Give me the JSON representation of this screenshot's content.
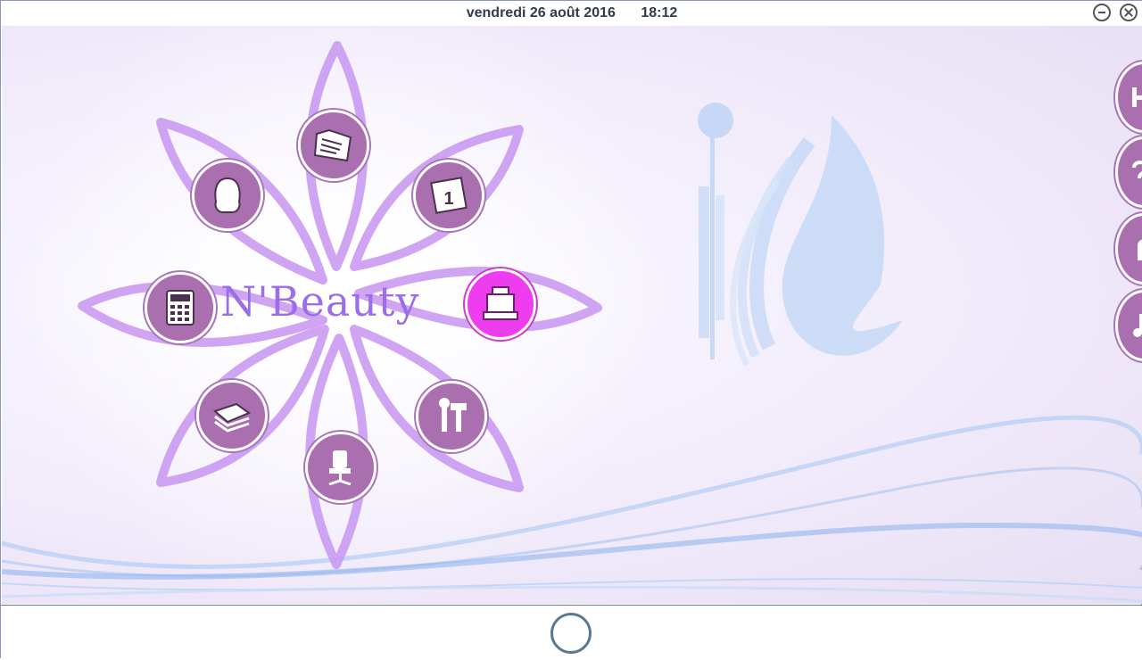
{
  "topbar": {
    "date": "vendredi 26 août 2016",
    "time": "18:12"
  },
  "window": {
    "minimize_icon": "minimize-icon",
    "close_icon": "close-icon"
  },
  "logo": {
    "text": "N'Beauty",
    "color": "#9a6ee8"
  },
  "menu": {
    "items": [
      {
        "icon": "folder-documents-icon"
      },
      {
        "icon": "calendar-icon"
      },
      {
        "icon": "cash-register-icon",
        "active": true
      },
      {
        "icon": "tools-icon"
      },
      {
        "icon": "office-chair-icon"
      },
      {
        "icon": "reports-icon"
      },
      {
        "icon": "calculator-icon"
      },
      {
        "icon": "woman-hair-icon"
      }
    ],
    "accent_color": "#a96fae",
    "active_color": "#ee3dee",
    "petal_color": "#c99af2"
  },
  "side_buttons": [
    {
      "icon": "home-letter-icon"
    },
    {
      "icon": "help-icon"
    },
    {
      "icon": "facebook-icon"
    },
    {
      "icon": "music-icon"
    }
  ],
  "bottombar": {
    "icon": "home-circle-icon"
  }
}
